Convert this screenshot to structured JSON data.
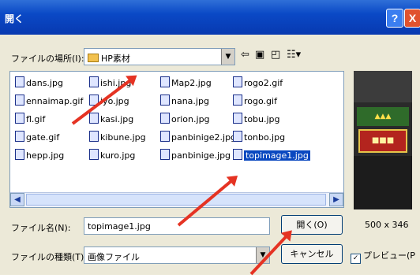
{
  "window": {
    "title": "開く",
    "help_label": "?",
    "close_label": "X"
  },
  "location": {
    "label": "ファイルの場所(I):",
    "value": "HP素材",
    "folder_icon": "folder-icon",
    "nav_icons": [
      "back-arrow-icon",
      "up-folder-icon",
      "new-folder-icon",
      "view-menu-icon"
    ]
  },
  "files": [
    "dans.jpg",
    "ennaimap.gif",
    "fl.gif",
    "gate.gif",
    "hepp.jpg",
    "ishi.jpg",
    "iyo.jpg",
    "kasi.jpg",
    "kibune.jpg",
    "kuro.jpg",
    "Map2.jpg",
    "nana.jpg",
    "orion.jpg",
    "panbinige2.jpg",
    "panbinige.jpg",
    "rogo2.gif",
    "rogo.gif",
    "tobu.jpg",
    "tonbo.jpg",
    "topimage1.jpg"
  ],
  "selected_file": "topimage1.jpg",
  "filename": {
    "label": "ファイル名(N):",
    "value": "topimage1.jpg"
  },
  "filetype": {
    "label": "ファイルの種類(T):",
    "value": "画像ファイル"
  },
  "buttons": {
    "open": "開く(O)",
    "cancel": "キャンセル"
  },
  "preview": {
    "size": "500 x 346",
    "checkbox_label": "プレビュー(P",
    "checked": true
  },
  "colors": {
    "titlebar": "#0a49c6",
    "selection": "#0a48c0",
    "annotation_arrow": "#e53323"
  }
}
